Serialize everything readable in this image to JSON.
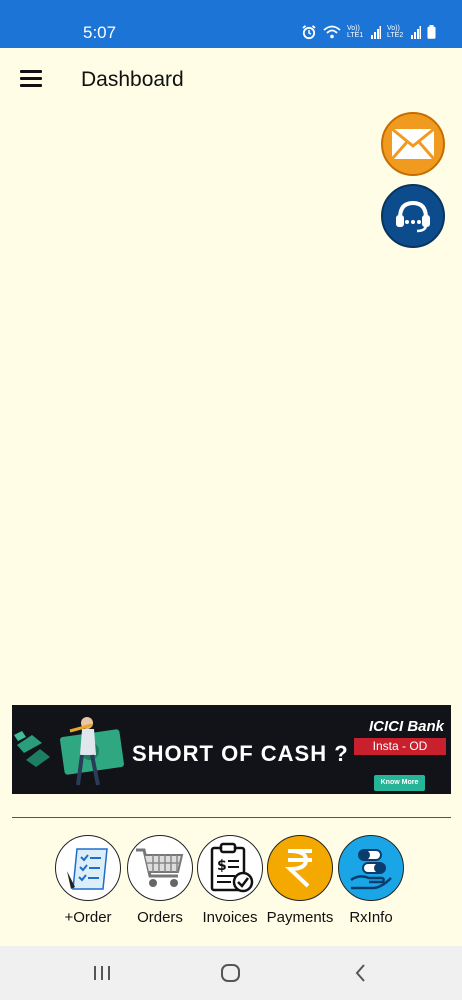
{
  "status_bar": {
    "time": "5:07",
    "icons": [
      "alarm-icon",
      "wifi-icon",
      "signal-sim1-icon",
      "signal-sim2-icon",
      "battery-icon"
    ],
    "sim1_label": "Vo)) LTE1",
    "sim2_label": "Vo)) LTE2"
  },
  "app_bar": {
    "title": "Dashboard"
  },
  "colors": {
    "status_bar": "#1b74d6",
    "background": "#fffde6",
    "mail_fab": "#f19a20",
    "support_fab": "#0d4c8c",
    "payments_accent": "#f4a900",
    "rxinfo_accent": "#1aa6e6"
  },
  "banner": {
    "headline": "SHORT OF CASH ?",
    "bank_name": "ICICI Bank",
    "product": "Insta - OD",
    "cta": "Know More"
  },
  "bottom_nav": {
    "items": [
      {
        "label": "+Order",
        "icon": "checklist-icon"
      },
      {
        "label": "Orders",
        "icon": "cart-icon"
      },
      {
        "label": "Invoices",
        "icon": "invoice-icon"
      },
      {
        "label": "Payments",
        "icon": "rupee-icon"
      },
      {
        "label": "RxInfo",
        "icon": "medicine-icon"
      }
    ]
  },
  "system_nav": {
    "icons": [
      "recent-apps-icon",
      "home-icon",
      "back-icon"
    ]
  }
}
